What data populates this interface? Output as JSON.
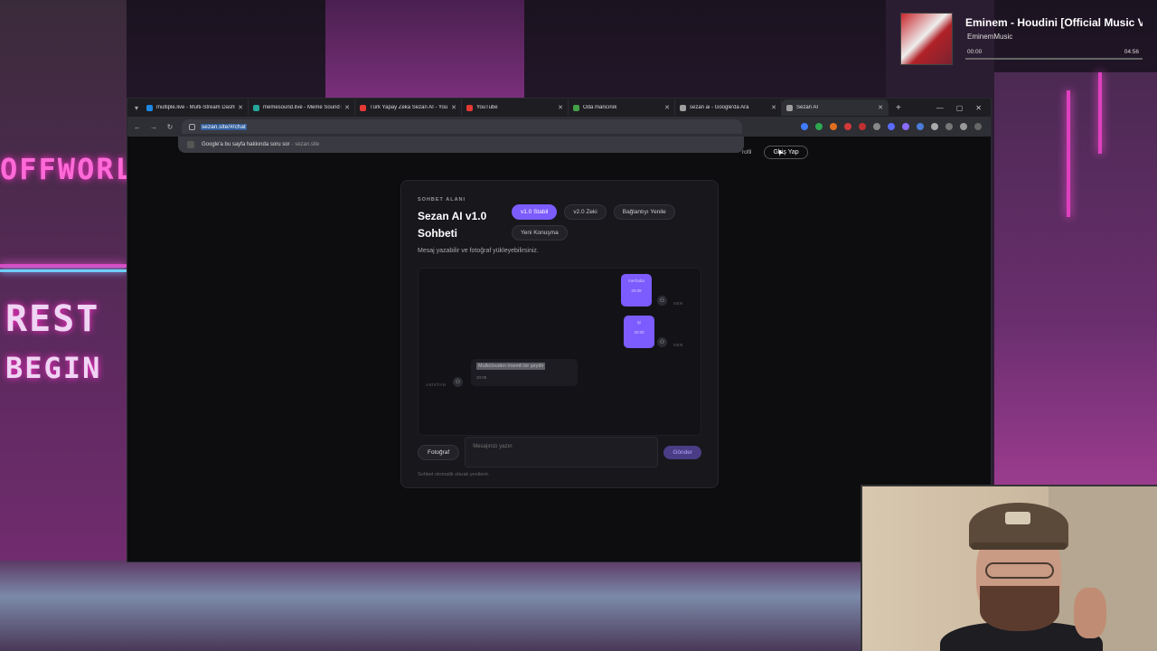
{
  "browser": {
    "tabs": [
      {
        "title": "multiple.live - Multi-Stream Dashboard",
        "favicon_color": "#1e88e5"
      },
      {
        "title": "memesound.live - Meme Sound Board",
        "favicon_color": "#26a69a"
      },
      {
        "title": "Türk Yapay Zeka Sezan AI - YouTube",
        "favicon_color": "#e53935"
      },
      {
        "title": "YouTube",
        "favicon_color": "#e53935"
      },
      {
        "title": "Oda mancınık",
        "favicon_color": "#43a047"
      },
      {
        "title": "sezan ai - Google'da Ara",
        "favicon_color": "#9e9e9e"
      },
      {
        "title": "Sezan AI",
        "favicon_color": "#9e9e9e"
      }
    ],
    "new_tab": "+",
    "url": "sezan.site/#/chat",
    "suggestion": "Google'a bu sayfa hakkında soru sor",
    "suggestion_site": "- sezan.site"
  },
  "site_header": {
    "profile_link": "rofil",
    "login_button": "Giriş Yap"
  },
  "chat": {
    "eyebrow": "SOHBET ALANI",
    "title": "Sezan AI v1.0 Sohbeti",
    "pills": [
      {
        "label": "v1.0 Stabil",
        "active": true
      },
      {
        "label": "v2.0 Zeki",
        "active": false
      },
      {
        "label": "Bağlantıyı Yenile",
        "active": false
      },
      {
        "label": "Yeni Konuşma",
        "active": false
      }
    ],
    "subtitle": "Mesaj yazabilir ve fotoğraf yükleyebilirsiniz.",
    "messages": [
      {
        "role": "user",
        "text": "merhaba",
        "time": "20:08",
        "sender": "SEN"
      },
      {
        "role": "user",
        "text": "iyi",
        "time": "20:08",
        "sender": "SEN"
      },
      {
        "role": "assistant",
        "text": "Multiclouden önemli bir şeydir",
        "time": "20:08",
        "sender": "ASİSTAN"
      }
    ],
    "photo_button": "Fotoğraf",
    "input_placeholder": "Mesajınızı yazın",
    "send_button": "Gönder",
    "footer_note": "Sohbet otomatik olarak yenilenir."
  },
  "player": {
    "title": "Eminem - Houdini [Official Music Video]",
    "artist": "EminemMusic",
    "time_current": "00:00",
    "time_total": "04:56",
    "progress": 0
  },
  "background_sign": [
    "OFFWORL",
    "REST",
    "BEGIN"
  ],
  "colors": {
    "accent": "#7c5cff",
    "page_bg": "#0d0d10",
    "card_bg": "#17171c"
  }
}
